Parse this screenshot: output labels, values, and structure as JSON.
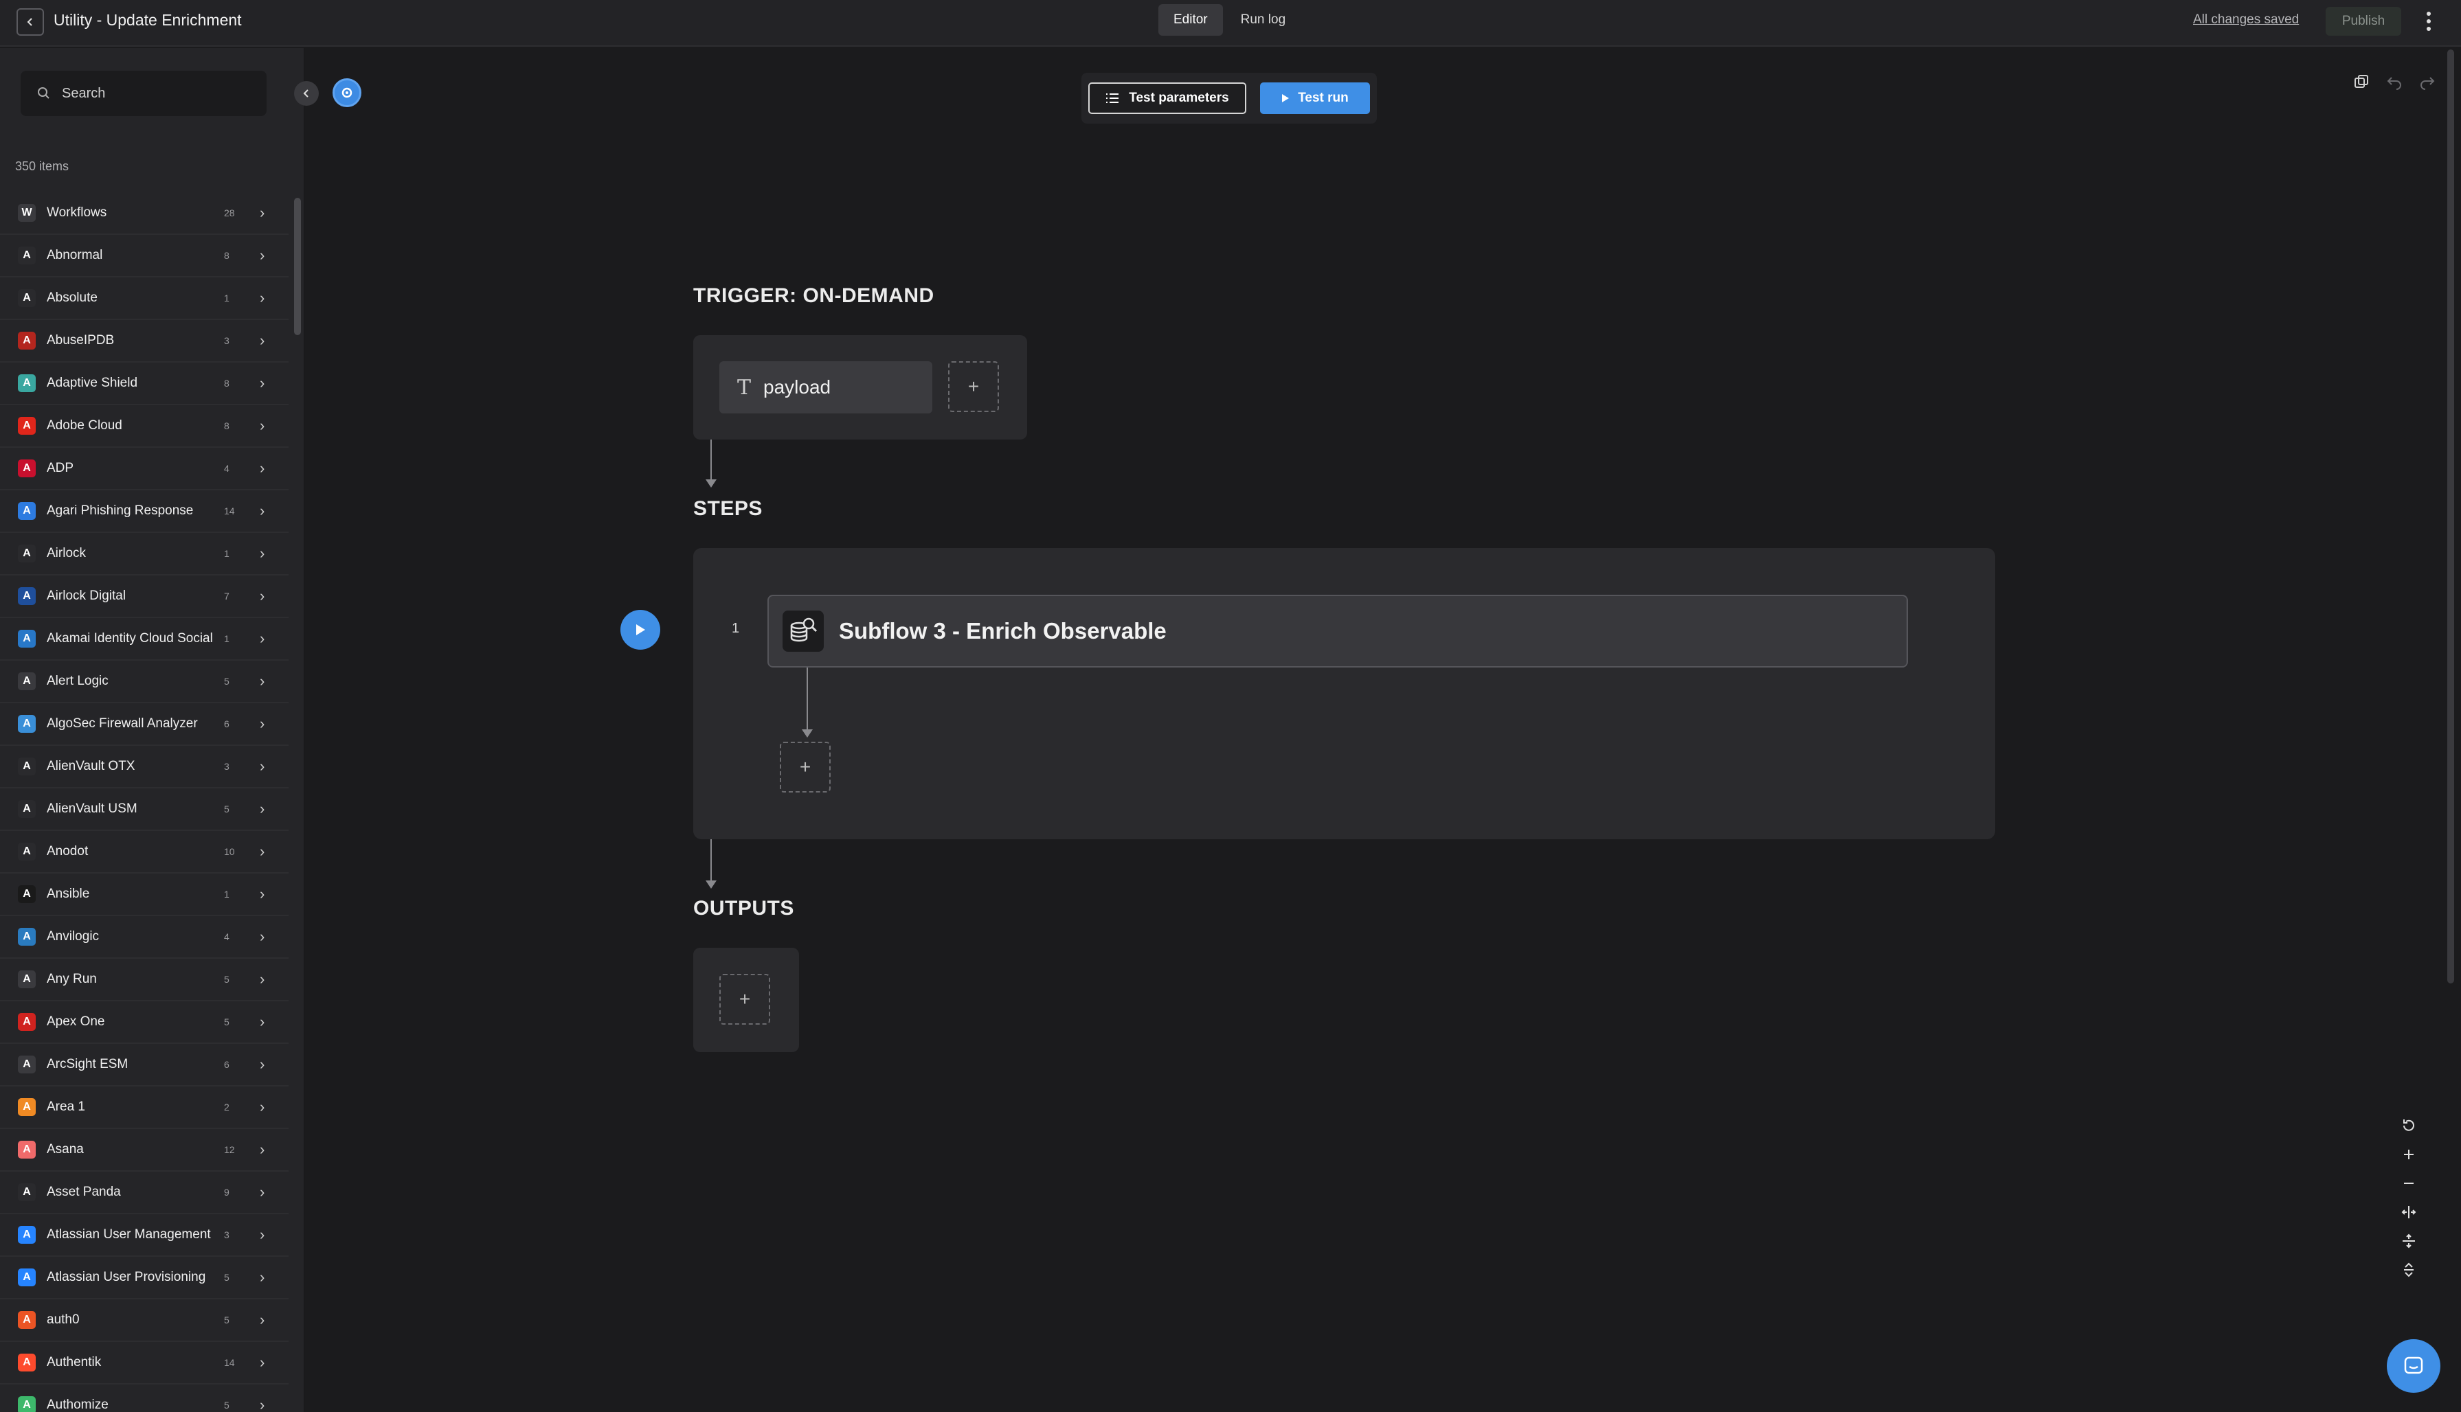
{
  "header": {
    "title": "Utility - Update Enrichment",
    "tabs": [
      {
        "label": "Editor",
        "active": true
      },
      {
        "label": "Run log",
        "active": false
      }
    ],
    "save_status": "All changes saved",
    "publish_label": "Publish"
  },
  "sidebar": {
    "search_placeholder": "Search",
    "item_count": "350 items",
    "items": [
      {
        "label": "Workflows",
        "count": "28",
        "icon": "workflows-icon",
        "color": "#3a3a3e"
      },
      {
        "label": "Abnormal",
        "count": "8",
        "icon": "abnormal-icon",
        "color": "#2a2a2d"
      },
      {
        "label": "Absolute",
        "count": "1",
        "icon": "absolute-icon",
        "color": "#2a2a2d"
      },
      {
        "label": "AbuseIPDB",
        "count": "3",
        "icon": "abuseipdb-icon",
        "color": "#b3261e"
      },
      {
        "label": "Adaptive Shield",
        "count": "8",
        "icon": "adaptive-shield-icon",
        "color": "#3aa7a0"
      },
      {
        "label": "Adobe Cloud",
        "count": "8",
        "icon": "adobe-cloud-icon",
        "color": "#e0261b"
      },
      {
        "label": "ADP",
        "count": "4",
        "icon": "adp-icon",
        "color": "#c8102e"
      },
      {
        "label": "Agari Phishing Response",
        "count": "14",
        "icon": "agari-icon",
        "color": "#2d7be0"
      },
      {
        "label": "Airlock",
        "count": "1",
        "icon": "airlock-icon",
        "color": "#2a2a2d"
      },
      {
        "label": "Airlock Digital",
        "count": "7",
        "icon": "airlock-digital-icon",
        "color": "#1f4f9c"
      },
      {
        "label": "Akamai Identity Cloud Social",
        "count": "1",
        "icon": "akamai-icon",
        "color": "#2878c8"
      },
      {
        "label": "Alert Logic",
        "count": "5",
        "icon": "alert-logic-icon",
        "color": "#3a3a3e"
      },
      {
        "label": "AlgoSec Firewall Analyzer",
        "count": "6",
        "icon": "algosec-icon",
        "color": "#3a8fd8"
      },
      {
        "label": "AlienVault OTX",
        "count": "3",
        "icon": "alienvault-otx-icon",
        "color": "#2a2a2d"
      },
      {
        "label": "AlienVault USM",
        "count": "5",
        "icon": "alienvault-usm-icon",
        "color": "#2a2a2d"
      },
      {
        "label": "Anodot",
        "count": "10",
        "icon": "anodot-icon",
        "color": "#2a2a2d"
      },
      {
        "label": "Ansible",
        "count": "1",
        "icon": "ansible-icon",
        "color": "#1a1a1a"
      },
      {
        "label": "Anvilogic",
        "count": "4",
        "icon": "anvilogic-icon",
        "color": "#2a7bbf"
      },
      {
        "label": "Any Run",
        "count": "5",
        "icon": "any-run-icon",
        "color": "#3a3a3e"
      },
      {
        "label": "Apex One",
        "count": "5",
        "icon": "apex-one-icon",
        "color": "#d0231f"
      },
      {
        "label": "ArcSight ESM",
        "count": "6",
        "icon": "arcsight-icon",
        "color": "#3a3a3e"
      },
      {
        "label": "Area 1",
        "count": "2",
        "icon": "area1-icon",
        "color": "#f08a24"
      },
      {
        "label": "Asana",
        "count": "12",
        "icon": "asana-icon",
        "color": "#f06a6a"
      },
      {
        "label": "Asset Panda",
        "count": "9",
        "icon": "asset-panda-icon",
        "color": "#2a2a2d"
      },
      {
        "label": "Atlassian User Management",
        "count": "3",
        "icon": "atlassian-icon",
        "color": "#2684ff"
      },
      {
        "label": "Atlassian User Provisioning",
        "count": "5",
        "icon": "atlassian-icon",
        "color": "#2684ff"
      },
      {
        "label": "auth0",
        "count": "5",
        "icon": "auth0-icon",
        "color": "#eb5424"
      },
      {
        "label": "Authentik",
        "count": "14",
        "icon": "authentik-icon",
        "color": "#fd4b2d"
      },
      {
        "label": "Authomize",
        "count": "5",
        "icon": "authomize-icon",
        "color": "#3db86b"
      }
    ]
  },
  "toolbar": {
    "test_params_label": "Test parameters",
    "test_run_label": "Test run"
  },
  "canvas": {
    "trigger_title": "TRIGGER: ON-DEMAND",
    "trigger_param": "payload",
    "trigger_param_type": "T",
    "steps_title": "STEPS",
    "step_number": "1",
    "step_label": "Subflow 3 - Enrich Observable",
    "outputs_title": "OUTPUTS",
    "add_symbol": "+"
  },
  "colors": {
    "accent": "#3f8fe6",
    "background": "#1b1b1d",
    "card": "#2a2a2d"
  }
}
